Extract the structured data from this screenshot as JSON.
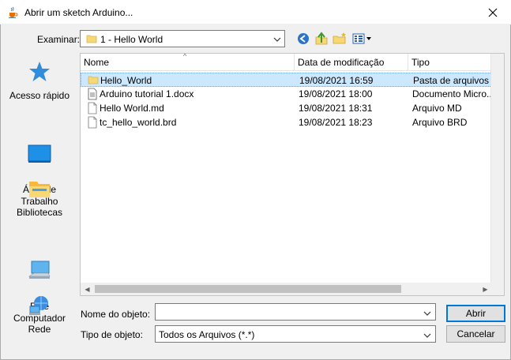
{
  "window": {
    "title": "Abrir um sketch Arduino...",
    "app_icon": "java-cup-icon",
    "close_icon": "close-icon"
  },
  "lookin": {
    "label": "Examinar:",
    "value": "1 - Hello World",
    "toolbar_icons": [
      "back-icon",
      "up-folder-icon",
      "new-folder-icon",
      "view-menu-icon"
    ]
  },
  "sidebar": {
    "items": [
      {
        "label": "Acesso rápido",
        "icon": "quick-access-star-icon"
      },
      {
        "label": "Área de\nTrabalho",
        "icon": "desktop-icon"
      },
      {
        "label": "Bibliotecas",
        "icon": "libraries-icon"
      },
      {
        "label": "Este\nComputador",
        "icon": "computer-icon"
      },
      {
        "label": "Rede",
        "icon": "network-icon"
      }
    ]
  },
  "filelist": {
    "columns": [
      "Nome",
      "Data de modificação",
      "Tipo"
    ],
    "rows": [
      {
        "name": "Hello_World",
        "date": "19/08/2021 16:59",
        "type": "Pasta de arquivos",
        "icon": "folder-icon",
        "selected": true
      },
      {
        "name": "Arduino tutorial 1.docx",
        "date": "19/08/2021 18:00",
        "type": "Documento Micro...",
        "icon": "document-icon",
        "selected": false
      },
      {
        "name": "Hello World.md",
        "date": "19/08/2021 18:31",
        "type": "Arquivo MD",
        "icon": "file-icon",
        "selected": false
      },
      {
        "name": "tc_hello_world.brd",
        "date": "19/08/2021 18:23",
        "type": "Arquivo BRD",
        "icon": "file-icon",
        "selected": false
      }
    ]
  },
  "filename": {
    "label": "Nome do objeto:",
    "value": ""
  },
  "filetype": {
    "label": "Tipo de objeto:",
    "value": "Todos os Arquivos (*.*)"
  },
  "buttons": {
    "open": "Abrir",
    "cancel": "Cancelar"
  },
  "colors": {
    "selection": "#cce8ff",
    "default_button_border": "#0078d7",
    "folder": "#f8d775"
  }
}
